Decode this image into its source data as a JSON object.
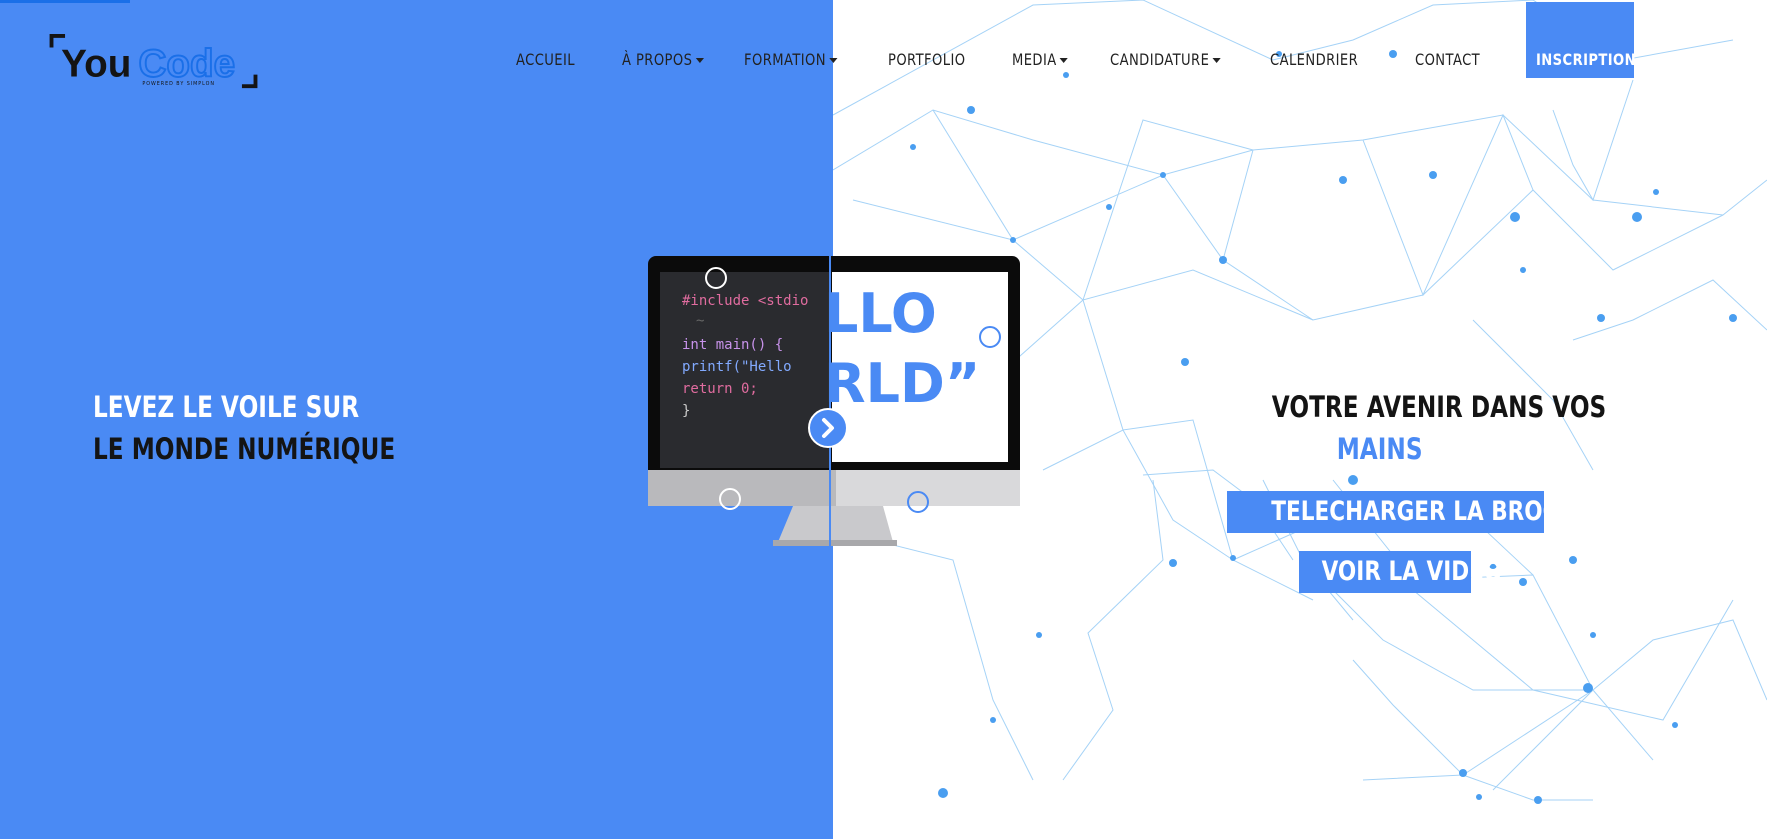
{
  "brand": {
    "name": "YouCode",
    "name_part1": "You",
    "name_part2": "Code",
    "tagline": "POWERED BY SIMPLON"
  },
  "nav": {
    "items": [
      {
        "label": "ACCUEIL",
        "dropdown": false
      },
      {
        "label": "À PROPOS",
        "dropdown": true
      },
      {
        "label": "FORMATION",
        "dropdown": true
      },
      {
        "label": "PORTFOLIO",
        "dropdown": false
      },
      {
        "label": "MEDIA",
        "dropdown": true
      },
      {
        "label": "CANDIDATURE",
        "dropdown": true
      },
      {
        "label": "CALENDRIER",
        "dropdown": false
      },
      {
        "label": "CONTACT",
        "dropdown": false
      }
    ],
    "cta": "INSCRIPTION"
  },
  "hero": {
    "left_line1": "LEVEZ LE VOILE SUR",
    "left_line2": "LE MONDE NUMÉRIQUE",
    "right_line1": "VOTRE AVENIR DANS VOS",
    "right_line2": "MAINS",
    "brochure_button": "TELECHARGER LA BROCHURE",
    "video_button": "VOIR LA VIDEO"
  },
  "monitor": {
    "code_lines": [
      "#include <stdio",
      "~",
      "int main() {",
      "  printf(\"Hello",
      "  return 0;",
      "}"
    ],
    "hello_line1": "LLO",
    "hello_line2": "RLD”"
  },
  "colors": {
    "accent": "#4a8af4",
    "dark": "#141414",
    "network": "#7cc0f2"
  },
  "icons": {
    "slider_arrow": "chevron-right-icon"
  }
}
